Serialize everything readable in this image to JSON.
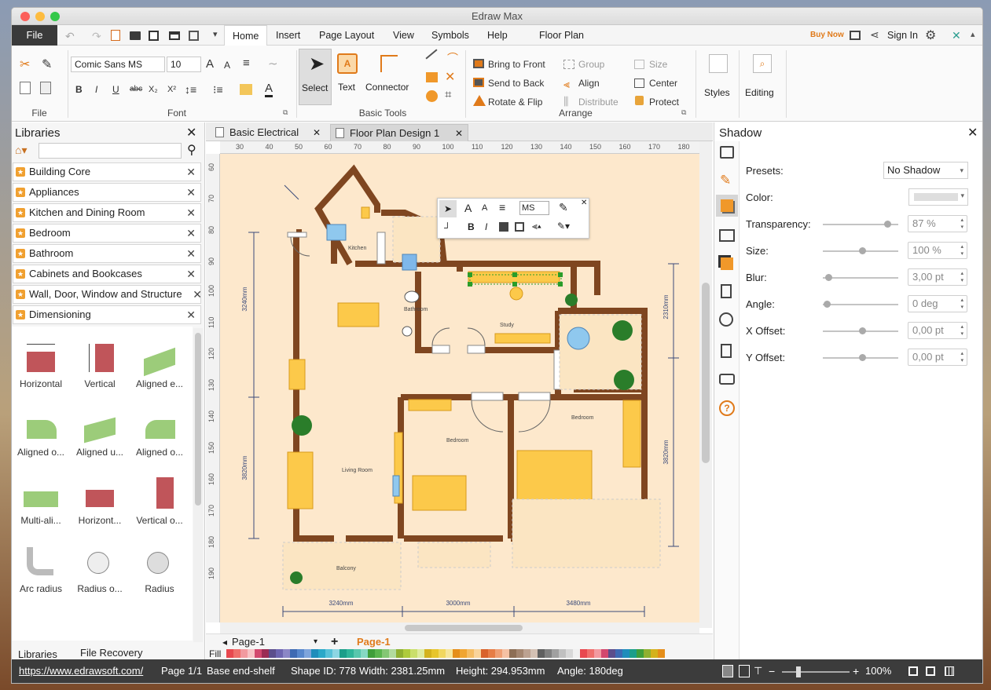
{
  "window": {
    "title": "Edraw Max"
  },
  "menu": {
    "file": "File",
    "tabs": [
      "Home",
      "Insert",
      "Page Layout",
      "View",
      "Symbols",
      "Help",
      "Floor Plan"
    ],
    "buy_now": "Buy Now",
    "sign_in": "Sign In"
  },
  "ribbon": {
    "groups": {
      "file": "File",
      "font": "Font",
      "basic_tools": "Basic Tools",
      "arrange": "Arrange"
    },
    "font_name": "Comic Sans MS",
    "font_size": "10",
    "select": "Select",
    "text": "Text",
    "connector": "Connector",
    "bring_to_front": "Bring to Front",
    "send_to_back": "Send to Back",
    "rotate_flip": "Rotate & Flip",
    "group": "Group",
    "align": "Align",
    "distribute": "Distribute",
    "size": "Size",
    "center": "Center",
    "protect": "Protect",
    "styles": "Styles",
    "editing": "Editing"
  },
  "libraries": {
    "title": "Libraries",
    "items": [
      "Building Core",
      "Appliances",
      "Kitchen and Dining Room",
      "Bedroom",
      "Bathroom",
      "Cabinets and Bookcases",
      "Wall, Door, Window and Structure",
      "Dimensioning"
    ],
    "shapes": [
      "Horizontal",
      "Vertical",
      "Aligned e...",
      "Aligned o...",
      "Aligned u...",
      "Aligned o...",
      "Multi-ali...",
      "Horizont...",
      "Vertical o...",
      "Arc radius",
      "Radius o...",
      "Radius"
    ],
    "bottom_tabs": [
      "Libraries",
      "File Recovery"
    ]
  },
  "documents": {
    "tabs": [
      "Basic Electrical",
      "Floor Plan Design 1"
    ]
  },
  "ruler": {
    "h": [
      "30",
      "40",
      "50",
      "60",
      "70",
      "80",
      "90",
      "100",
      "110",
      "120",
      "130",
      "140",
      "150",
      "160",
      "170",
      "180"
    ],
    "v": [
      "60",
      "70",
      "80",
      "90",
      "100",
      "110",
      "120",
      "130",
      "140",
      "150",
      "160",
      "170",
      "180",
      "190"
    ]
  },
  "floorplan": {
    "rooms": {
      "kitchen": "Kitchen",
      "bathroom": "Bathroom",
      "study": "Study",
      "living": "Living Room",
      "bedroom1": "Bedroom",
      "bedroom2": "Bedroom",
      "balcony": "Balcony"
    },
    "dims": {
      "left_top": "3240mm",
      "left_bottom": "3820mm",
      "right_top": "2310mm",
      "right_bottom": "3820mm",
      "bottom1": "3240mm",
      "bottom2": "3000mm",
      "bottom3": "3480mm"
    }
  },
  "floating_toolbar": {
    "font": "MS"
  },
  "pagebar": {
    "page": "Page-1",
    "active_page": "Page-1",
    "fill_label": "Fill"
  },
  "shadow_panel": {
    "title": "Shadow",
    "presets_label": "Presets:",
    "presets_value": "No Shadow",
    "color_label": "Color:",
    "transparency_label": "Transparency:",
    "transparency_value": "87 %",
    "transparency_level": 0.87,
    "size_label": "Size:",
    "size_value": "100 %",
    "blur_label": "Blur:",
    "blur_value": "3,00 pt",
    "angle_label": "Angle:",
    "angle_value": "0 deg",
    "xoffset_label": "X Offset:",
    "xoffset_value": "0,00 pt",
    "yoffset_label": "Y Offset:",
    "yoffset_value": "0,00 pt"
  },
  "status": {
    "url": "https://www.edrawsoft.com/",
    "page": "Page 1/1",
    "shape_name": "Base end-shelf",
    "shape_id": "Shape ID: 778",
    "width": "Width: 2381.25mm",
    "height": "Height: 294.953mm",
    "angle": "Angle: 180deg",
    "zoom": "100%"
  },
  "palette": [
    "#e8484f",
    "#ef6f6c",
    "#f29aa0",
    "#f7c3c6",
    "#d3486e",
    "#9b2c54",
    "#5b4e8c",
    "#6d65b0",
    "#8b87c6",
    "#3d6ab3",
    "#5687cc",
    "#7ea5dc",
    "#1f8dbb",
    "#2aa8c8",
    "#58c1d8",
    "#8dd6e3",
    "#1b9e8a",
    "#2fb59a",
    "#58c7ad",
    "#86d8c3",
    "#3f9e3a",
    "#5ab54e",
    "#84c774",
    "#b2db9e",
    "#8fb030",
    "#aecb3c",
    "#cadf6b",
    "#dfeb9e",
    "#d4b21d",
    "#e7c52c",
    "#f1d75e",
    "#f6e59a",
    "#e58e1a",
    "#f0a531",
    "#f5bd64",
    "#f9d49b",
    "#d9622b",
    "#e77d46",
    "#ef9f74",
    "#f5c1a4",
    "#8d6e55",
    "#a48670",
    "#bca291",
    "#d4c1b4",
    "#606060",
    "#808080",
    "#a0a0a0",
    "#c0c0c0",
    "#d8d8d8",
    "#f0f0f0",
    "#e8484f",
    "#ef6f6c",
    "#f29aa0",
    "#d3486e",
    "#5b4e8c",
    "#3d6ab3",
    "#1f8dbb",
    "#1b9e8a",
    "#3f9e3a",
    "#8fb030",
    "#d4b21d",
    "#e58e1a"
  ]
}
